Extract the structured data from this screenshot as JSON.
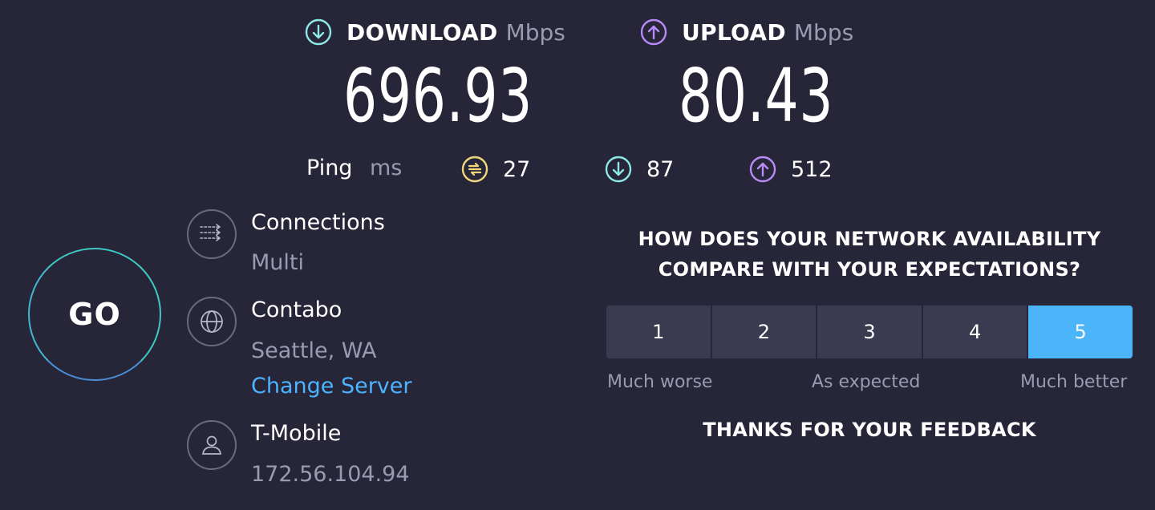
{
  "download": {
    "label": "DOWNLOAD",
    "unit": "Mbps",
    "value": "696.93",
    "color": "#8ee8e6"
  },
  "upload": {
    "label": "UPLOAD",
    "unit": "Mbps",
    "value": "80.43",
    "color": "#b88af5"
  },
  "ping": {
    "label": "Ping",
    "unit": "ms",
    "idle": "27",
    "download": "87",
    "upload": "512",
    "idle_color": "#f2d87a"
  },
  "go_button": {
    "label": "GO"
  },
  "connections": {
    "title": "Connections",
    "value": "Multi",
    "icon": "connections-icon"
  },
  "server": {
    "title": "Contabo",
    "location": "Seattle, WA",
    "change_label": "Change Server",
    "icon": "globe-icon"
  },
  "isp": {
    "title": "T-Mobile",
    "ip": "172.56.104.94",
    "icon": "user-icon"
  },
  "feedback": {
    "question_line1": "HOW DOES YOUR NETWORK AVAILABILITY",
    "question_line2": "COMPARE WITH YOUR EXPECTATIONS?",
    "options": [
      "1",
      "2",
      "3",
      "4",
      "5"
    ],
    "selected": "5",
    "label_low": "Much worse",
    "label_mid": "As expected",
    "label_high": "Much better",
    "thanks": "THANKS FOR YOUR FEEDBACK"
  },
  "colors": {
    "background": "#262638",
    "accent": "#4cb5f9",
    "link": "#4db3ff"
  }
}
